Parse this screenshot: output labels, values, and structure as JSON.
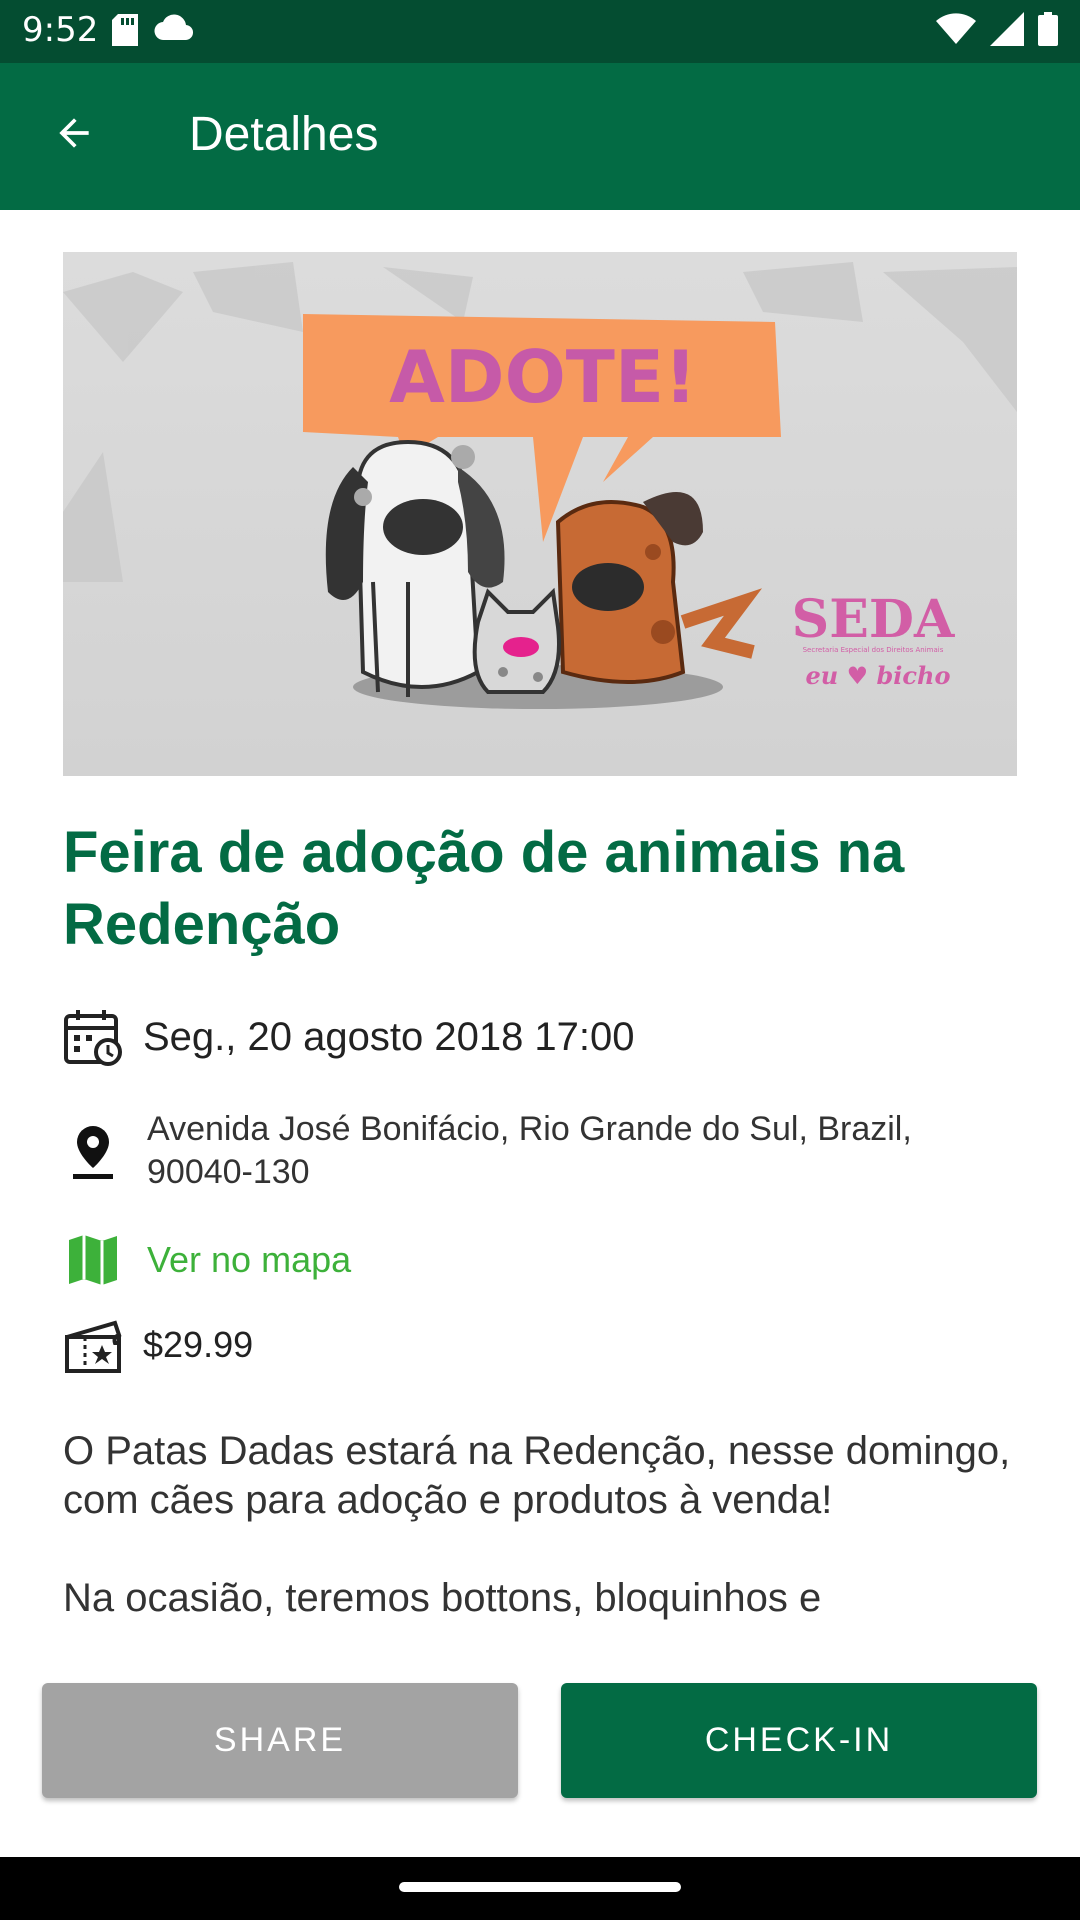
{
  "status_bar": {
    "time": "9:52",
    "icons": [
      "sd-card-icon",
      "cloud-icon",
      "wifi-icon",
      "signal-icon",
      "battery-icon"
    ]
  },
  "app_bar": {
    "back_icon": "arrow-back-icon",
    "title": "Detalhes"
  },
  "hero_image": {
    "speech_bubble_text": "ADOTE!",
    "logo_text": "SEDA",
    "logo_tagline": "eu ♥ bicho",
    "logo_subtitle": "Secretaria Especial dos Direitos Animais"
  },
  "event": {
    "title": "Feira de adoção de animais na Redenção",
    "date_icon": "calendar-clock-icon",
    "date": "Seg., 20 agosto 2018 17:00",
    "location_icon": "map-pin-icon",
    "address": "Avenida José Bonifácio, Rio Grande do Sul, Brazil, 90040-130",
    "map_icon": "map-icon",
    "map_link": "Ver no mapa",
    "price_icon": "ticket-icon",
    "price": "$29.99",
    "description_1": "O Patas Dadas estará na Redenção, nesse domingo, com cães para adoção e produtos à venda!",
    "description_2": "Na ocasião, teremos bottons, bloquinhos e"
  },
  "actions": {
    "share_label": "SHARE",
    "checkin_label": "CHECK-IN"
  },
  "colors": {
    "status_bar": "#044d31",
    "primary": "#036b44",
    "link_green": "#3db13a",
    "share_gray": "#a3a3a3"
  }
}
